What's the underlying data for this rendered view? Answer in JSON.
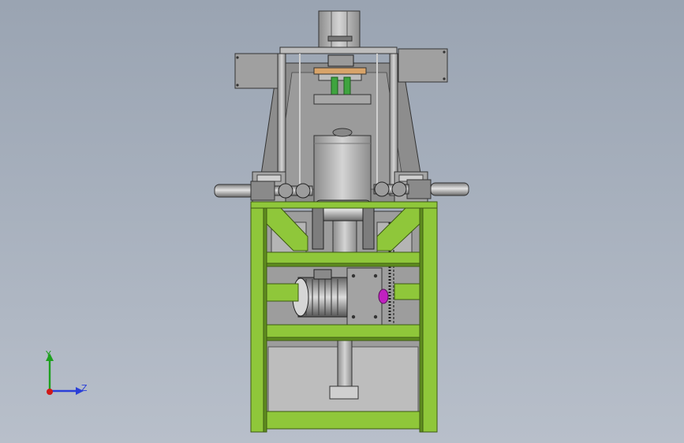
{
  "viewport": {
    "background_top": "#9aa4b2",
    "background_bottom": "#b8bfca"
  },
  "model": {
    "frame_color": "#8fc73a",
    "frame_shadow": "#5f8d1f",
    "steel_color": "#b9b9b9",
    "dark_steel": "#6f6f6f",
    "accent_green": "#3fa43f",
    "accent_magenta": "#c020c0",
    "accent_orange": "#d8a46a"
  },
  "triad": {
    "y_label": "Y",
    "z_label": "Z",
    "y_color": "#1ea01e",
    "z_color": "#2a3fd8",
    "x_color": "#d01818"
  }
}
